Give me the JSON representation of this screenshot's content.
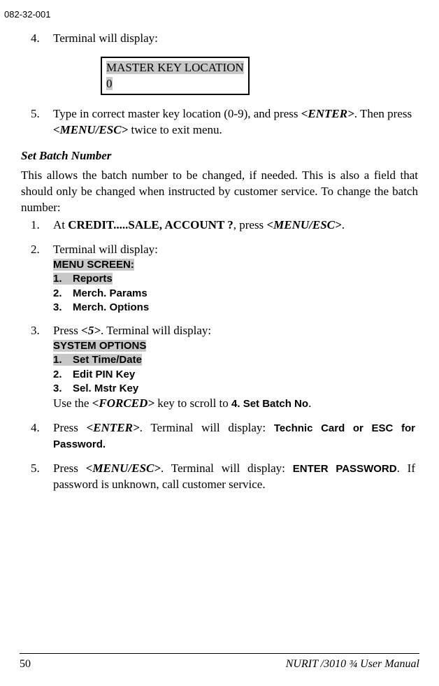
{
  "docId": "082-32-001",
  "step4": {
    "num": "4.",
    "text": "Terminal will display:"
  },
  "terminal1": {
    "line1": "MASTER KEY LOCATION",
    "line2": "0"
  },
  "step5": {
    "num": "5.",
    "pre": "Type in correct master key location (0-9), and press ",
    "key1": "<ENTER>",
    "mid": ". Then press ",
    "key2": "<MENU/ESC>",
    "post": " twice to exit menu."
  },
  "section": {
    "heading": "Set Batch Number",
    "para": "This allows the batch number to be changed, if needed.  This is also a field that should only be changed when instructed by customer service.  To change the batch number:"
  },
  "s1": {
    "num": "1.",
    "pre": "At  ",
    "bold": "CREDIT.....SALE, ACCOUNT ?",
    "mid": ", press ",
    "key": "<MENU/ESC>",
    "post": "."
  },
  "s2": {
    "num": "2.",
    "text": "Terminal will display:",
    "menuTitle": "MENU SCREEN:",
    "m1n": "1.",
    "m1t": "Reports",
    "m2n": "2.",
    "m2t": "Merch. Params",
    "m3n": "3.",
    "m3t": "Merch. Options"
  },
  "s3": {
    "num": "3.",
    "pre": "Press ",
    "key": "<5>",
    "post": ".  Terminal will display:",
    "menuTitle": "SYSTEM OPTIONS",
    "m1n": "1.",
    "m1t": "Set Time/Date",
    "m2n": "2.",
    "m2t": "Edit PIN Key",
    "m3n": "3.",
    "m3t": "Sel. Mstr Key",
    "useA": "Use the ",
    "forced": "<FORCED>",
    "useB": " key to scroll to ",
    "target": "4. Set Batch No",
    "useC": "."
  },
  "s4": {
    "num": "4.",
    "pre": "Press ",
    "key": "<ENTER>",
    "mid": ". Terminal will display: ",
    "bold": "Technic Card or ESC for Password."
  },
  "s5": {
    "num": "5.",
    "pre": "Press ",
    "key": "<MENU/ESC>",
    "mid": ". Terminal will display: ",
    "bold": "ENTER PASSWORD",
    "post": ".  If password is unknown, call customer service."
  },
  "footer": {
    "page": "50",
    "manual": "NURIT /3010 ¾ User Manual"
  }
}
